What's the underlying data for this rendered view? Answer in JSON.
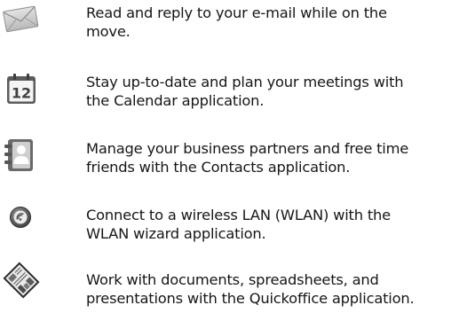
{
  "items": [
    {
      "icon": "envelope-icon",
      "lines": [
        "Read and reply to your e-mail while on the",
        "move."
      ]
    },
    {
      "icon": "calendar-icon",
      "calendar_day": "12",
      "lines": [
        "Stay up-to-date and plan your meetings with",
        "the Calendar application."
      ]
    },
    {
      "icon": "contacts-icon",
      "lines": [
        "Manage your business partners and free time",
        "friends with the Contacts application."
      ]
    },
    {
      "icon": "wlan-icon",
      "lines": [
        "Connect to a wireless LAN (WLAN) with the",
        "WLAN wizard application."
      ]
    },
    {
      "icon": "quickoffice-icon",
      "lines": [
        "Work with documents, spreadsheets, and",
        "presentations with the Quickoffice application."
      ]
    }
  ]
}
